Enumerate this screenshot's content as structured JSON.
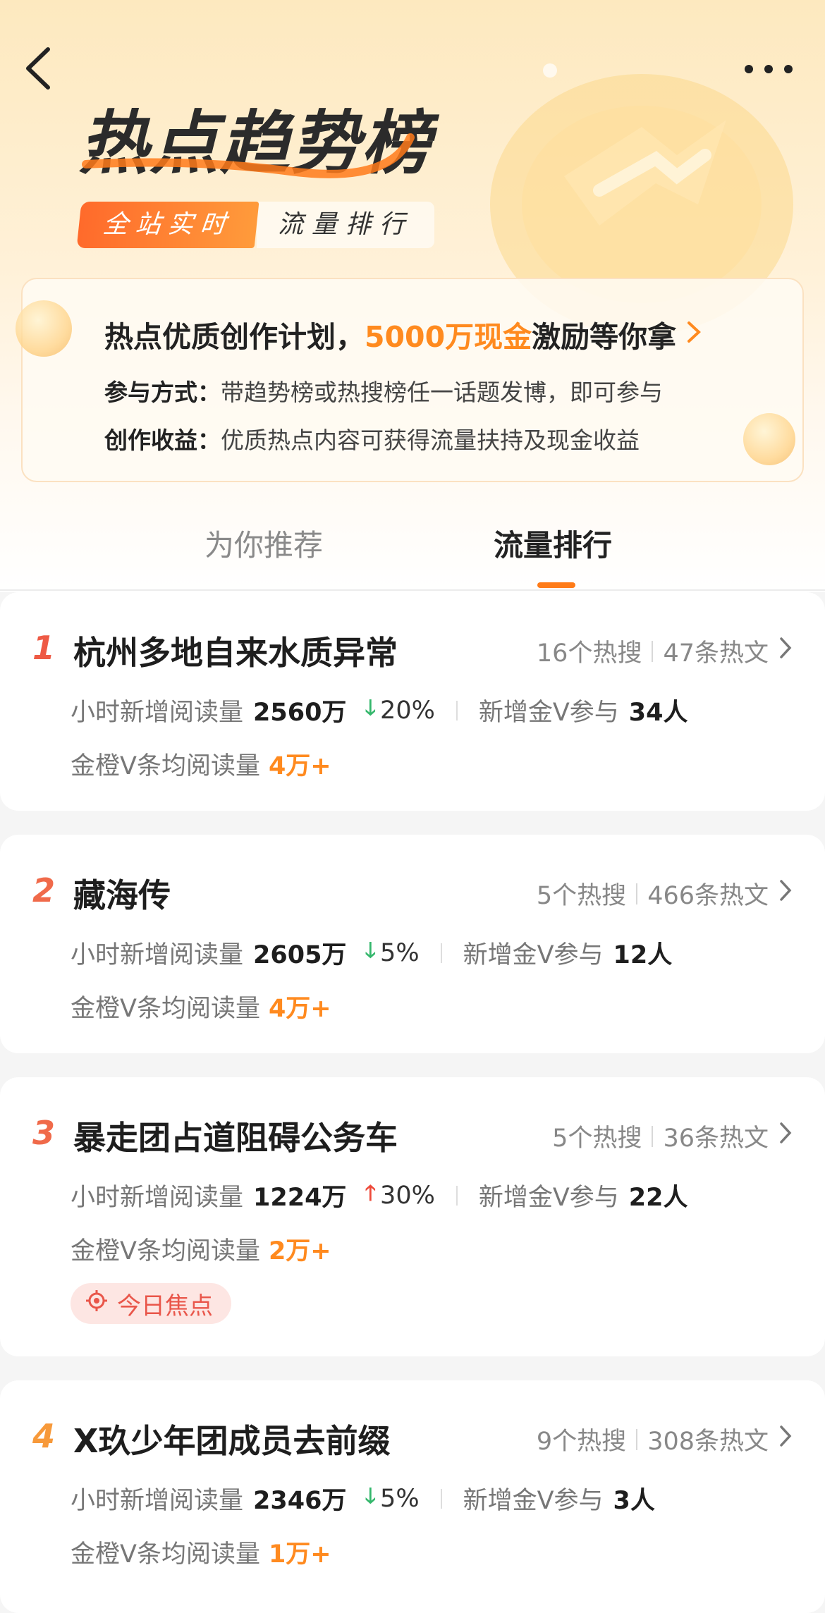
{
  "header": {
    "title": "热点趋势榜",
    "pill_primary": "全站实时",
    "pill_secondary": "流量排行"
  },
  "promo": {
    "title_before": "热点优质创作计划，",
    "title_highlight": "5000万现金",
    "title_after": "激励等你拿",
    "line1_label": "参与方式：",
    "line1_text": "带趋势榜或热搜榜任一话题发博，即可参与",
    "line2_label": "创作收益：",
    "line2_text": "优质热点内容可获得流量扶持及现金收益"
  },
  "tabs": [
    {
      "label": "为你推荐",
      "active": false
    },
    {
      "label": "流量排行",
      "active": true
    }
  ],
  "stat_labels": {
    "hourly_reads": "小时新增阅读量",
    "new_v": "新增金V参与",
    "avg_reads": "金橙V条均阅读量"
  },
  "items": [
    {
      "rank": "1",
      "title": "杭州多地自来水质异常",
      "hot_search": "16个热搜",
      "hot_posts": "47条热文",
      "reads": "2560万",
      "trend": "down",
      "trend_pct": "20%",
      "new_v": "34人",
      "avg": "4万+",
      "tag": ""
    },
    {
      "rank": "2",
      "title": "藏海传",
      "hot_search": "5个热搜",
      "hot_posts": "466条热文",
      "reads": "2605万",
      "trend": "down",
      "trend_pct": "5%",
      "new_v": "12人",
      "avg": "4万+",
      "tag": ""
    },
    {
      "rank": "3",
      "title": "暴走团占道阻碍公务车",
      "hot_search": "5个热搜",
      "hot_posts": "36条热文",
      "reads": "1224万",
      "trend": "up",
      "trend_pct": "30%",
      "new_v": "22人",
      "avg": "2万+",
      "tag": "今日焦点"
    },
    {
      "rank": "4",
      "title": "X玖少年团成员去前缀",
      "hot_search": "9个热搜",
      "hot_posts": "308条热文",
      "reads": "2346万",
      "trend": "down",
      "trend_pct": "5%",
      "new_v": "3人",
      "avg": "1万+",
      "tag": ""
    }
  ],
  "colors": {
    "accent": "#ff8a1f",
    "rank1": "#ee5a45",
    "rank2": "#f06a4a",
    "rank3": "#f06a4a",
    "rank4": "#f7993a",
    "trend_down": "#35b76c",
    "trend_up": "#ee4b3b"
  },
  "icons": {
    "back": "chevron-left-icon",
    "more": "more-dots-icon",
    "trend_down": "arrow-down-icon",
    "trend_up": "arrow-up-icon",
    "focus": "target-icon"
  }
}
